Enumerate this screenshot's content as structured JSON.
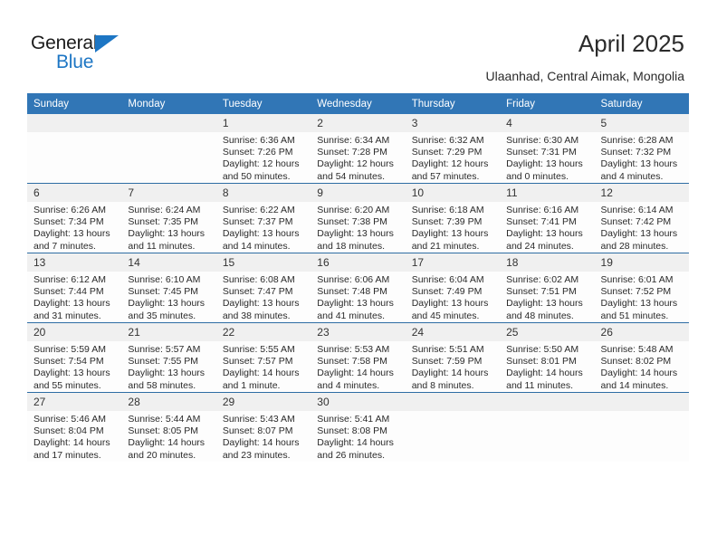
{
  "brand": {
    "name_top": "General",
    "name_bottom": "Blue",
    "accent_color": "#1d76c4"
  },
  "header": {
    "title": "April 2025",
    "subtitle": "Ulaanhad, Central Aimak, Mongolia"
  },
  "calendar": {
    "header_bg": "#3176b6",
    "daynum_bg": "#f0f0f0",
    "separator_color": "#2e6da4",
    "weekday_headers": [
      "Sunday",
      "Monday",
      "Tuesday",
      "Wednesday",
      "Thursday",
      "Friday",
      "Saturday"
    ],
    "weeks": [
      [
        {
          "day": "",
          "sunrise": "",
          "sunset": "",
          "daylight": ""
        },
        {
          "day": "",
          "sunrise": "",
          "sunset": "",
          "daylight": ""
        },
        {
          "day": "1",
          "sunrise": "Sunrise: 6:36 AM",
          "sunset": "Sunset: 7:26 PM",
          "daylight": "Daylight: 12 hours and 50 minutes."
        },
        {
          "day": "2",
          "sunrise": "Sunrise: 6:34 AM",
          "sunset": "Sunset: 7:28 PM",
          "daylight": "Daylight: 12 hours and 54 minutes."
        },
        {
          "day": "3",
          "sunrise": "Sunrise: 6:32 AM",
          "sunset": "Sunset: 7:29 PM",
          "daylight": "Daylight: 12 hours and 57 minutes."
        },
        {
          "day": "4",
          "sunrise": "Sunrise: 6:30 AM",
          "sunset": "Sunset: 7:31 PM",
          "daylight": "Daylight: 13 hours and 0 minutes."
        },
        {
          "day": "5",
          "sunrise": "Sunrise: 6:28 AM",
          "sunset": "Sunset: 7:32 PM",
          "daylight": "Daylight: 13 hours and 4 minutes."
        }
      ],
      [
        {
          "day": "6",
          "sunrise": "Sunrise: 6:26 AM",
          "sunset": "Sunset: 7:34 PM",
          "daylight": "Daylight: 13 hours and 7 minutes."
        },
        {
          "day": "7",
          "sunrise": "Sunrise: 6:24 AM",
          "sunset": "Sunset: 7:35 PM",
          "daylight": "Daylight: 13 hours and 11 minutes."
        },
        {
          "day": "8",
          "sunrise": "Sunrise: 6:22 AM",
          "sunset": "Sunset: 7:37 PM",
          "daylight": "Daylight: 13 hours and 14 minutes."
        },
        {
          "day": "9",
          "sunrise": "Sunrise: 6:20 AM",
          "sunset": "Sunset: 7:38 PM",
          "daylight": "Daylight: 13 hours and 18 minutes."
        },
        {
          "day": "10",
          "sunrise": "Sunrise: 6:18 AM",
          "sunset": "Sunset: 7:39 PM",
          "daylight": "Daylight: 13 hours and 21 minutes."
        },
        {
          "day": "11",
          "sunrise": "Sunrise: 6:16 AM",
          "sunset": "Sunset: 7:41 PM",
          "daylight": "Daylight: 13 hours and 24 minutes."
        },
        {
          "day": "12",
          "sunrise": "Sunrise: 6:14 AM",
          "sunset": "Sunset: 7:42 PM",
          "daylight": "Daylight: 13 hours and 28 minutes."
        }
      ],
      [
        {
          "day": "13",
          "sunrise": "Sunrise: 6:12 AM",
          "sunset": "Sunset: 7:44 PM",
          "daylight": "Daylight: 13 hours and 31 minutes."
        },
        {
          "day": "14",
          "sunrise": "Sunrise: 6:10 AM",
          "sunset": "Sunset: 7:45 PM",
          "daylight": "Daylight: 13 hours and 35 minutes."
        },
        {
          "day": "15",
          "sunrise": "Sunrise: 6:08 AM",
          "sunset": "Sunset: 7:47 PM",
          "daylight": "Daylight: 13 hours and 38 minutes."
        },
        {
          "day": "16",
          "sunrise": "Sunrise: 6:06 AM",
          "sunset": "Sunset: 7:48 PM",
          "daylight": "Daylight: 13 hours and 41 minutes."
        },
        {
          "day": "17",
          "sunrise": "Sunrise: 6:04 AM",
          "sunset": "Sunset: 7:49 PM",
          "daylight": "Daylight: 13 hours and 45 minutes."
        },
        {
          "day": "18",
          "sunrise": "Sunrise: 6:02 AM",
          "sunset": "Sunset: 7:51 PM",
          "daylight": "Daylight: 13 hours and 48 minutes."
        },
        {
          "day": "19",
          "sunrise": "Sunrise: 6:01 AM",
          "sunset": "Sunset: 7:52 PM",
          "daylight": "Daylight: 13 hours and 51 minutes."
        }
      ],
      [
        {
          "day": "20",
          "sunrise": "Sunrise: 5:59 AM",
          "sunset": "Sunset: 7:54 PM",
          "daylight": "Daylight: 13 hours and 55 minutes."
        },
        {
          "day": "21",
          "sunrise": "Sunrise: 5:57 AM",
          "sunset": "Sunset: 7:55 PM",
          "daylight": "Daylight: 13 hours and 58 minutes."
        },
        {
          "day": "22",
          "sunrise": "Sunrise: 5:55 AM",
          "sunset": "Sunset: 7:57 PM",
          "daylight": "Daylight: 14 hours and 1 minute."
        },
        {
          "day": "23",
          "sunrise": "Sunrise: 5:53 AM",
          "sunset": "Sunset: 7:58 PM",
          "daylight": "Daylight: 14 hours and 4 minutes."
        },
        {
          "day": "24",
          "sunrise": "Sunrise: 5:51 AM",
          "sunset": "Sunset: 7:59 PM",
          "daylight": "Daylight: 14 hours and 8 minutes."
        },
        {
          "day": "25",
          "sunrise": "Sunrise: 5:50 AM",
          "sunset": "Sunset: 8:01 PM",
          "daylight": "Daylight: 14 hours and 11 minutes."
        },
        {
          "day": "26",
          "sunrise": "Sunrise: 5:48 AM",
          "sunset": "Sunset: 8:02 PM",
          "daylight": "Daylight: 14 hours and 14 minutes."
        }
      ],
      [
        {
          "day": "27",
          "sunrise": "Sunrise: 5:46 AM",
          "sunset": "Sunset: 8:04 PM",
          "daylight": "Daylight: 14 hours and 17 minutes."
        },
        {
          "day": "28",
          "sunrise": "Sunrise: 5:44 AM",
          "sunset": "Sunset: 8:05 PM",
          "daylight": "Daylight: 14 hours and 20 minutes."
        },
        {
          "day": "29",
          "sunrise": "Sunrise: 5:43 AM",
          "sunset": "Sunset: 8:07 PM",
          "daylight": "Daylight: 14 hours and 23 minutes."
        },
        {
          "day": "30",
          "sunrise": "Sunrise: 5:41 AM",
          "sunset": "Sunset: 8:08 PM",
          "daylight": "Daylight: 14 hours and 26 minutes."
        },
        {
          "day": "",
          "sunrise": "",
          "sunset": "",
          "daylight": ""
        },
        {
          "day": "",
          "sunrise": "",
          "sunset": "",
          "daylight": ""
        },
        {
          "day": "",
          "sunrise": "",
          "sunset": "",
          "daylight": ""
        }
      ]
    ]
  }
}
